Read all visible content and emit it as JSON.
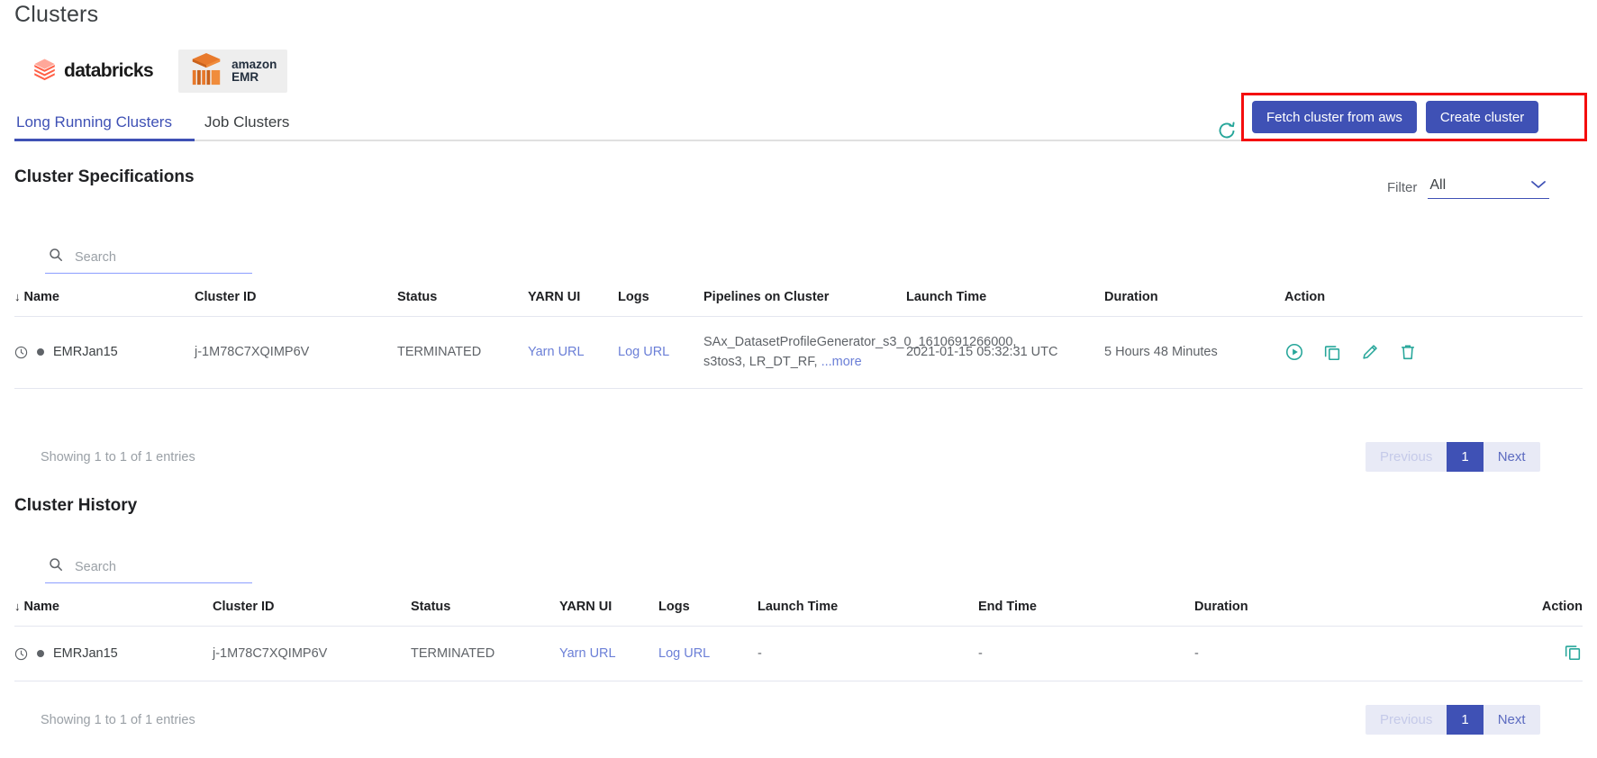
{
  "header": {
    "title": "Clusters",
    "providers": [
      {
        "name": "databricks",
        "label": "databricks",
        "selected": false
      },
      {
        "name": "amazon-emr",
        "label_top": "amazon",
        "label_bottom": "EMR",
        "selected": true
      }
    ]
  },
  "tabs": [
    {
      "label": "Long Running Clusters",
      "active": true
    },
    {
      "label": "Job Clusters",
      "active": false
    }
  ],
  "toolbar": {
    "refresh_icon": "refresh-icon",
    "fetch_label": "Fetch cluster from aws",
    "create_label": "Create cluster",
    "highlight_color": "#f40d0d",
    "primary_color": "#3f51b5"
  },
  "specifications": {
    "title": "Cluster Specifications",
    "filter": {
      "label": "Filter",
      "value": "All"
    },
    "search": {
      "placeholder": "Search",
      "value": ""
    },
    "columns": [
      "Name",
      "Cluster ID",
      "Status",
      "YARN UI",
      "Logs",
      "Pipelines on Cluster",
      "Launch Time",
      "Duration",
      "Action"
    ],
    "sorted_column": "Name",
    "rows": [
      {
        "name": "EMRJan15",
        "cluster_id": "j-1M78C7XQIMP6V",
        "status": "TERMINATED",
        "yarn_ui": "Yarn URL",
        "logs": "Log URL",
        "pipelines": "SAx_DatasetProfileGenerator_s3_0_1610691266000, s3tos3, LR_DT_RF, ",
        "pipelines_more": "...more",
        "launch_time": "2021-01-15 05:32:31 UTC",
        "duration": "5 Hours 48 Minutes",
        "actions": [
          "play-circle-icon",
          "copy-icon",
          "edit-pencil-icon",
          "trash-icon"
        ]
      }
    ],
    "entries_text": "Showing 1 to 1 of 1 entries",
    "pagination": {
      "previous": "Previous",
      "pages": [
        "1"
      ],
      "current": "1",
      "next": "Next"
    }
  },
  "history": {
    "title": "Cluster History",
    "search": {
      "placeholder": "Search",
      "value": ""
    },
    "columns": [
      "Name",
      "Cluster ID",
      "Status",
      "YARN UI",
      "Logs",
      "Launch Time",
      "End Time",
      "Duration",
      "Action"
    ],
    "sorted_column": "Name",
    "rows": [
      {
        "name": "EMRJan15",
        "cluster_id": "j-1M78C7XQIMP6V",
        "status": "TERMINATED",
        "yarn_ui": "Yarn URL",
        "logs": "Log URL",
        "launch_time": "-",
        "end_time": "-",
        "duration": "-",
        "actions": [
          "copy-icon"
        ]
      }
    ],
    "entries_text": "Showing 1 to 1 of 1 entries",
    "pagination": {
      "previous": "Previous",
      "pages": [
        "1"
      ],
      "current": "1",
      "next": "Next"
    }
  },
  "colors": {
    "accent": "#3f51b5",
    "teal": "#26a69a",
    "link": "#6b7fd7",
    "highlight": "#f40d0d"
  }
}
